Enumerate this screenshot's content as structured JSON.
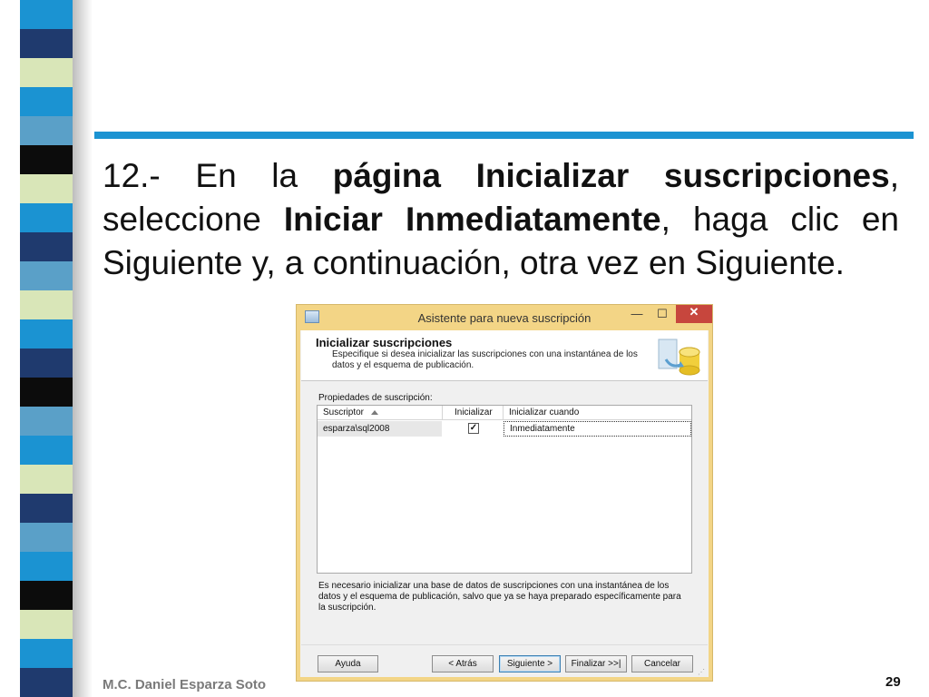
{
  "slide": {
    "paragraph": {
      "part1": "12.- En la ",
      "bold1": "página Inicializar suscripciones",
      "part2": ", seleccione ",
      "bold2": "Iniciar Inmediatamente",
      "part3": ", haga clic en Siguiente y, a continuación, otra vez en Siguiente."
    },
    "footer_author": "M.C. Daniel Esparza Soto",
    "page_number": "29",
    "colors": {
      "rule": "#1b93d2",
      "stripe": [
        "#1b93d2",
        "#1f3a6e",
        "#d9e6b8",
        "#5aa0c8",
        "#0c0c0c"
      ]
    }
  },
  "dialog": {
    "title": "Asistente para nueva suscripción",
    "titlebar_buttons": {
      "minimize": "—",
      "maximize": "☐",
      "close": "✕"
    },
    "heading": "Inicializar suscripciones",
    "description": "Especifique si desea inicializar las suscripciones con una instantánea de los datos y el esquema de publicación.",
    "props_label": "Propiedades de suscripción:",
    "grid": {
      "columns": [
        "Suscriptor",
        "Inicializar",
        "Inicializar cuando"
      ],
      "rows": [
        {
          "subscriber": "esparza\\sql2008",
          "initialize": true,
          "check_glyph": "✓",
          "when": "Inmediatamente"
        }
      ]
    },
    "note": "Es necesario inicializar una base de datos de suscripciones con una instantánea de los datos y el esquema de publicación, salvo que ya se haya preparado específicamente para la suscripción.",
    "buttons": {
      "help": "Ayuda",
      "back": "< Atrás",
      "next": "Siguiente >",
      "finish": "Finalizar >>|",
      "cancel": "Cancelar"
    },
    "icons": {
      "app": "wizard-app-icon",
      "banner": "database-sync-icon",
      "sort": "sort-ascending-icon"
    }
  }
}
